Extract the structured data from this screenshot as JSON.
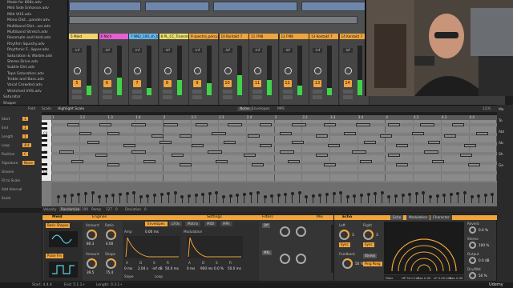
{
  "browser": {
    "items": [
      "Made for 808s.adv",
      "Mild Side Enhance.adv",
      "Mild VHS.adv",
      "Mono Dist...pander.adv",
      "Multiband Dist...ser.adv",
      "Multiband Stretch.adv",
      "Resample and Hold.adv",
      "Rhythm Squishy.adv",
      "Rhythmic F...lipper.adv",
      "Saturation & Warble.adv",
      "Stereo Drive.adv",
      "Subtle Dirt.adv",
      "Tape Saturation.adv",
      "Treble and Bass.adv",
      "Vocal Crowded.adv",
      "Wretched VHS.adv"
    ],
    "folders": [
      "Saturator",
      "Shaper"
    ]
  },
  "mixer": {
    "tracks": [
      {
        "name": "5 Mold",
        "color": "#f3d36b",
        "number": "5",
        "vol": "-inf"
      },
      {
        "name": "6 Ntch",
        "color": "#e65fd0",
        "number": "6",
        "vol": "-inf"
      },
      {
        "name": "7 NN2_100_sh_bl",
        "color": "#64b8f0",
        "number": "7",
        "vol": "-inf"
      },
      {
        "name": "8 PL_CC_Transmi",
        "color": "#e8e06a",
        "number": "8",
        "vol": "-inf"
      },
      {
        "name": "9 spectra_percu",
        "color": "#f0a43c",
        "number": "9",
        "vol": "-inf"
      },
      {
        "name": "10 Kontakt 7",
        "color": "#f0a43c",
        "number": "10",
        "vol": "-inf"
      },
      {
        "name": "11 FM8",
        "color": "#f0a43c",
        "number": "11",
        "vol": "-inf"
      },
      {
        "name": "12 FM8",
        "color": "#f0a43c",
        "number": "12",
        "vol": "-inf"
      },
      {
        "name": "13 Kontakt 7",
        "color": "#f0a43c",
        "number": "13",
        "vol": "-inf"
      },
      {
        "name": "14 Kontakt 7",
        "color": "#f0a43c",
        "number": "14",
        "vol": "-inf"
      }
    ],
    "right_labels": [
      "Ma",
      "To",
      "Abl",
      "Ab",
      "Sh",
      "Ge"
    ]
  },
  "clipview": {
    "title": "Highlight Scale",
    "tabs": [
      "Fold",
      "Scale",
      "Notes",
      "Envelopes",
      "MPE"
    ],
    "position": "1/16",
    "ruler": [
      "1",
      "1.2",
      "1.3",
      "1.4",
      "2",
      "2.2",
      "2.3",
      "2.4",
      "3",
      "3.2",
      "3.3",
      "3.4",
      "4",
      "4.2",
      "4.3",
      "4.4"
    ],
    "key_labels": [
      "C4",
      "C3",
      "C2"
    ],
    "props": [
      "Start",
      "End",
      "Length",
      "Loop",
      "Position",
      "Signature",
      "Groove",
      "Fit to Scale",
      "Add Interval",
      "Scale"
    ],
    "prop_values": [
      "1",
      "1",
      "1",
      "4/4",
      "C",
      "None"
    ]
  },
  "velocity_bar": {
    "items": [
      "Velocity",
      "Randomize",
      "Ramp",
      "Deviation",
      "0"
    ],
    "values": [
      "100",
      "127",
      "0"
    ]
  },
  "devices": {
    "drift": {
      "name": "Meld",
      "oscillators": [
        "A",
        "B"
      ],
      "osc_a": "Basic Shapes",
      "osc_b": "Pulse Fm",
      "knobs": [
        {
          "label": "Amount",
          "value": "80.3"
        },
        {
          "label": "Ratio",
          "value": "4.00"
        },
        {
          "label": "Amount",
          "value": "39.5"
        },
        {
          "label": "Shape",
          "value": "75.4"
        }
      ]
    },
    "engines_label": "Engines",
    "envelopes": {
      "tabs": [
        "Envelopes",
        "LFOs",
        "Matrix",
        "MIDI",
        "MPE"
      ],
      "amp_label": "Amp",
      "mod_label": "Modulation",
      "delay": "0.00 ms",
      "params": [
        "A",
        "D",
        "S",
        "R"
      ],
      "amp_values": [
        "0 ms",
        "2.04 s",
        "-inf dB",
        "50.0 ms"
      ],
      "mod_values": [
        "0 ms",
        "900 ms",
        "0.0 %",
        "50.0 ms"
      ],
      "slope": "Slope",
      "loop": "Loop"
    },
    "settings_label": "Settings",
    "filters": {
      "label": "Filters",
      "type1": "Off",
      "type2": "MKL"
    },
    "mix": {
      "label": "Mix"
    },
    "echo": {
      "name": "Echo",
      "tabs": [
        "Echo",
        "Modulation",
        "Character"
      ],
      "left_label": "Left",
      "right_label": "Right",
      "left_value": "3",
      "right_value": "3",
      "feedback": "Feedback",
      "feedback_value": "50 %",
      "buttons": [
        "Sync",
        "Sync",
        "Stereo",
        "Ping Pong"
      ],
      "knobs": [
        {
          "label": "Reverb",
          "value": "0.0 %"
        },
        {
          "label": "Stereo",
          "value": "100 %"
        },
        {
          "label": "Output",
          "value": "0.0 dB"
        },
        {
          "label": "Dry/Wet",
          "value": "50 %"
        }
      ],
      "footer": [
        "Filter",
        "HP 50.0 Hz",
        "Res 0.00",
        "LP 5.00 kHz",
        "Res 0.00"
      ]
    }
  },
  "statusbar": {
    "left": "Start: 4.4.4",
    "middle": "End: 5.1.1+",
    "right": "Length: 0.3.1+",
    "far_right": "Udemy"
  },
  "colors": {
    "accent": "#f0a43c",
    "meter": "#3fd34a"
  }
}
